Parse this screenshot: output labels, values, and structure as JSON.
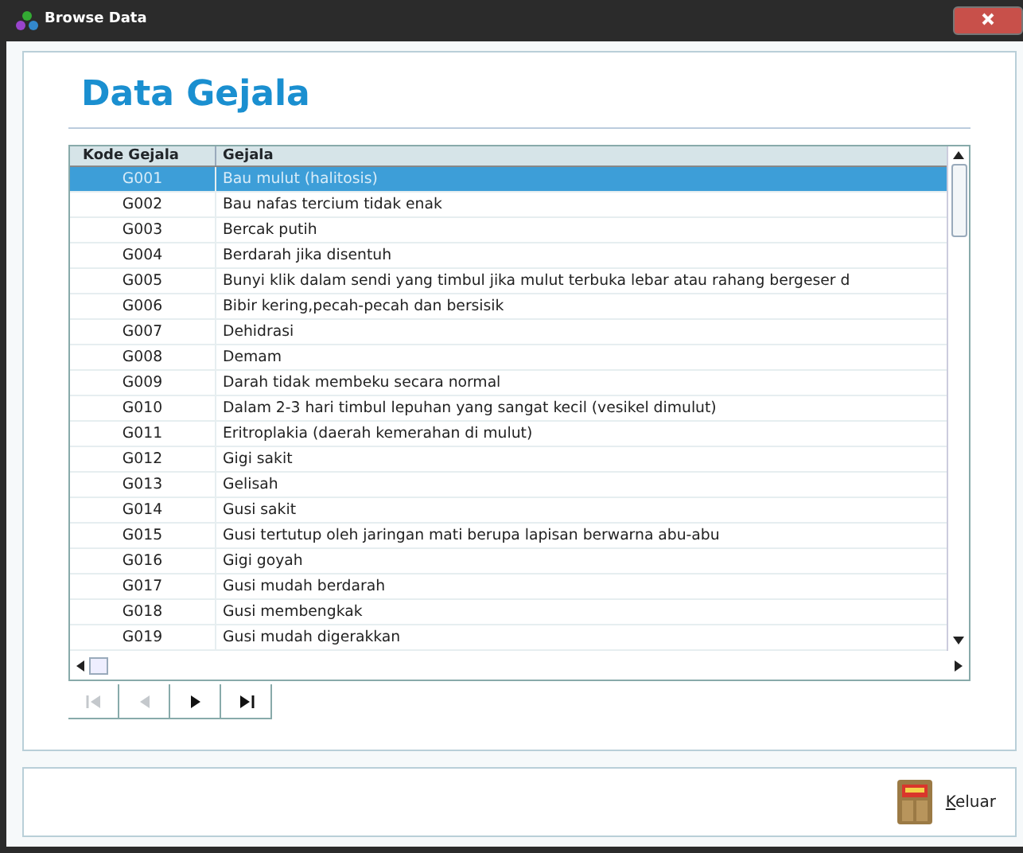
{
  "window": {
    "title": "Browse Data"
  },
  "heading": "Data Gejala",
  "table": {
    "columns": [
      "Kode Gejala",
      "Gejala"
    ],
    "rows": [
      {
        "code": "G001",
        "gejala": "Bau mulut (halitosis)",
        "selected": true
      },
      {
        "code": "G002",
        "gejala": "Bau nafas tercium tidak enak",
        "selected": false
      },
      {
        "code": "G003",
        "gejala": "Bercak putih",
        "selected": false
      },
      {
        "code": "G004",
        "gejala": "Berdarah jika disentuh",
        "selected": false
      },
      {
        "code": "G005",
        "gejala": "Bunyi klik dalam sendi yang timbul jika mulut terbuka lebar atau rahang bergeser d",
        "selected": false
      },
      {
        "code": "G006",
        "gejala": "Bibir kering,pecah-pecah dan bersisik",
        "selected": false
      },
      {
        "code": "G007",
        "gejala": "Dehidrasi",
        "selected": false
      },
      {
        "code": "G008",
        "gejala": "Demam",
        "selected": false
      },
      {
        "code": "G009",
        "gejala": "Darah tidak membeku secara normal",
        "selected": false
      },
      {
        "code": "G010",
        "gejala": "Dalam 2-3 hari timbul lepuhan yang sangat kecil (vesikel dimulut)",
        "selected": false
      },
      {
        "code": "G011",
        "gejala": "Eritroplakia (daerah kemerahan di mulut)",
        "selected": false
      },
      {
        "code": "G012",
        "gejala": "Gigi sakit",
        "selected": false
      },
      {
        "code": "G013",
        "gejala": "Gelisah",
        "selected": false
      },
      {
        "code": "G014",
        "gejala": "Gusi sakit",
        "selected": false
      },
      {
        "code": "G015",
        "gejala": "Gusi tertutup oleh jaringan mati berupa lapisan berwarna abu-abu",
        "selected": false
      },
      {
        "code": "G016",
        "gejala": "Gigi goyah",
        "selected": false
      },
      {
        "code": "G017",
        "gejala": "Gusi mudah berdarah",
        "selected": false
      },
      {
        "code": "G018",
        "gejala": "Gusi membengkak",
        "selected": false
      },
      {
        "code": "G019",
        "gejala": "Gusi mudah digerakkan",
        "selected": false
      }
    ]
  },
  "navigator": [
    {
      "kind": "first",
      "disabled": true
    },
    {
      "kind": "previous",
      "disabled": true
    },
    {
      "kind": "next",
      "disabled": false
    },
    {
      "kind": "last",
      "disabled": false
    }
  ],
  "exit_button": {
    "label": "Keluar",
    "mnemonic_underlined": true
  }
}
